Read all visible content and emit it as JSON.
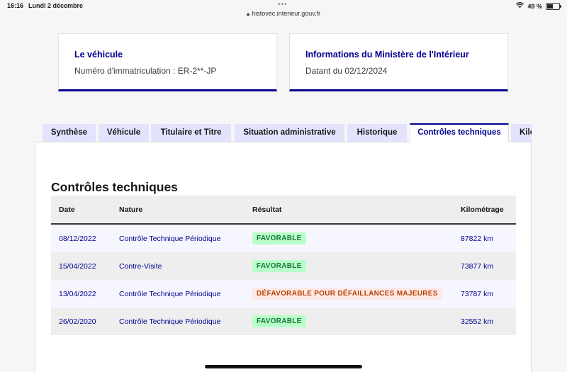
{
  "status_bar": {
    "time": "16:16",
    "date": "Lundi 2 décembre",
    "url": "histovec.interieur.gouv.fr",
    "battery": "49 %",
    "battery_level": 0.49
  },
  "cards": [
    {
      "title": "Le véhicule",
      "subtitle": "Numéro d'immatriculation : ER-2**-JP"
    },
    {
      "title": "Informations du Ministère de l'Intérieur",
      "subtitle": "Datant du 02/12/2024"
    }
  ],
  "tabs": [
    {
      "label": "Synthèse"
    },
    {
      "label": "Véhicule"
    },
    {
      "label": "Titulaire et Titre"
    },
    {
      "label": "Situation administrative"
    },
    {
      "label": "Historique"
    },
    {
      "label": "Contrôles techniques",
      "active": true
    },
    {
      "label": "Kilo"
    }
  ],
  "section": {
    "title": "Contrôles techniques",
    "headers": [
      "Date",
      "Nature",
      "Résultat",
      "Kilométrage"
    ],
    "rows": [
      {
        "date": "08/12/2022",
        "nature": "Contrôle Technique Périodique",
        "result": "FAVORABLE",
        "result_status": "ok",
        "km": "87822 km"
      },
      {
        "date": "15/04/2022",
        "nature": "Contre-Visite",
        "result": "FAVORABLE",
        "result_status": "ok",
        "km": "73877 km"
      },
      {
        "date": "13/04/2022",
        "nature": "Contrôle Technique Périodique",
        "result": "DÉFAVORABLE POUR DÉFAILLANCES MAJEURES",
        "result_status": "ko",
        "km": "73787 km"
      },
      {
        "date": "26/02/2020",
        "nature": "Contrôle Technique Périodique",
        "result": "FAVORABLE",
        "result_status": "ok",
        "km": "32552 km"
      }
    ]
  },
  "colors": {
    "primary": "#000091",
    "tab_bg": "#e3e3fd",
    "success_bg": "#b8fec9",
    "success_text": "#18753c",
    "error_bg": "#ffe9e6",
    "error_text": "#b34000"
  }
}
